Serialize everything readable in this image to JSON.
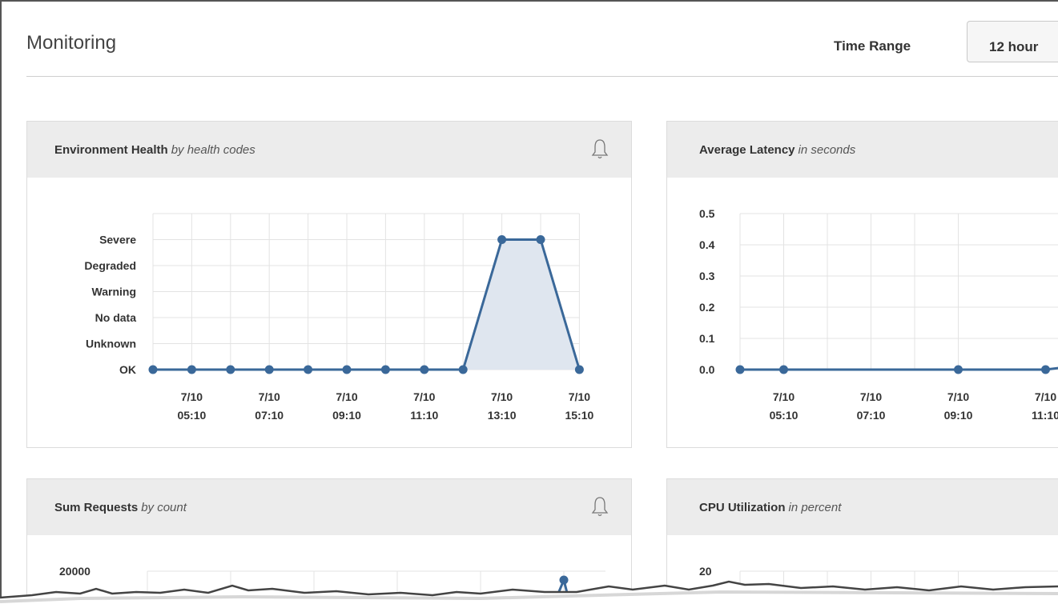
{
  "page": {
    "title": "Monitoring",
    "time_range_label": "Time Range",
    "time_range_value": "12 hour"
  },
  "colors": {
    "series": "#3a6899",
    "fill": "#dfe6ef",
    "panel_header": "#ececec",
    "grid": "#e3e3e3"
  },
  "panels": {
    "env_health": {
      "title": "Environment Health",
      "subtitle": "by health codes",
      "icon": "bell-icon"
    },
    "latency": {
      "title": "Average Latency",
      "subtitle": "in seconds"
    },
    "requests": {
      "title": "Sum Requests",
      "subtitle": "by count",
      "icon": "bell-icon"
    },
    "cpu": {
      "title": "CPU Utilization",
      "subtitle": "in percent"
    }
  },
  "chart_data": [
    {
      "type": "area",
      "title": "Environment Health by health codes",
      "y_categories": [
        "OK",
        "Unknown",
        "No data",
        "Warning",
        "Degraded",
        "Severe"
      ],
      "x_ticks": [
        [
          "7/10",
          "05:10"
        ],
        [
          "7/10",
          "07:10"
        ],
        [
          "7/10",
          "09:10"
        ],
        [
          "7/10",
          "11:10"
        ],
        [
          "7/10",
          "13:10"
        ],
        [
          "7/10",
          "15:10"
        ]
      ],
      "x_start": "7/10 04:10",
      "x_step_minutes": 60,
      "values": [
        0,
        0,
        0,
        0,
        0,
        0,
        0,
        0,
        0,
        5,
        5,
        0
      ],
      "grid": true
    },
    {
      "type": "line",
      "title": "Average Latency in seconds",
      "ylim": [
        0,
        0.5
      ],
      "y_ticks": [
        "0.0",
        "0.1",
        "0.2",
        "0.3",
        "0.4",
        "0.5"
      ],
      "x_ticks": [
        [
          "7/10",
          "05:10"
        ],
        [
          "7/10",
          "07:10"
        ],
        [
          "7/10",
          "09:10"
        ],
        [
          "7/10",
          "11:10"
        ]
      ],
      "points": [
        {
          "x": "7/10 04:10",
          "y": 0.0
        },
        {
          "x": "7/10 05:10",
          "y": 0.0
        },
        {
          "x": "7/10 09:10",
          "y": 0.0
        },
        {
          "x": "7/10 11:10",
          "y": 0.0
        }
      ],
      "grid": true
    },
    {
      "type": "line",
      "title": "Sum Requests by count",
      "y_ticks": [
        "20000"
      ],
      "grid": true
    },
    {
      "type": "line",
      "title": "CPU Utilization in percent",
      "y_ticks": [
        "20"
      ],
      "grid": true
    }
  ]
}
